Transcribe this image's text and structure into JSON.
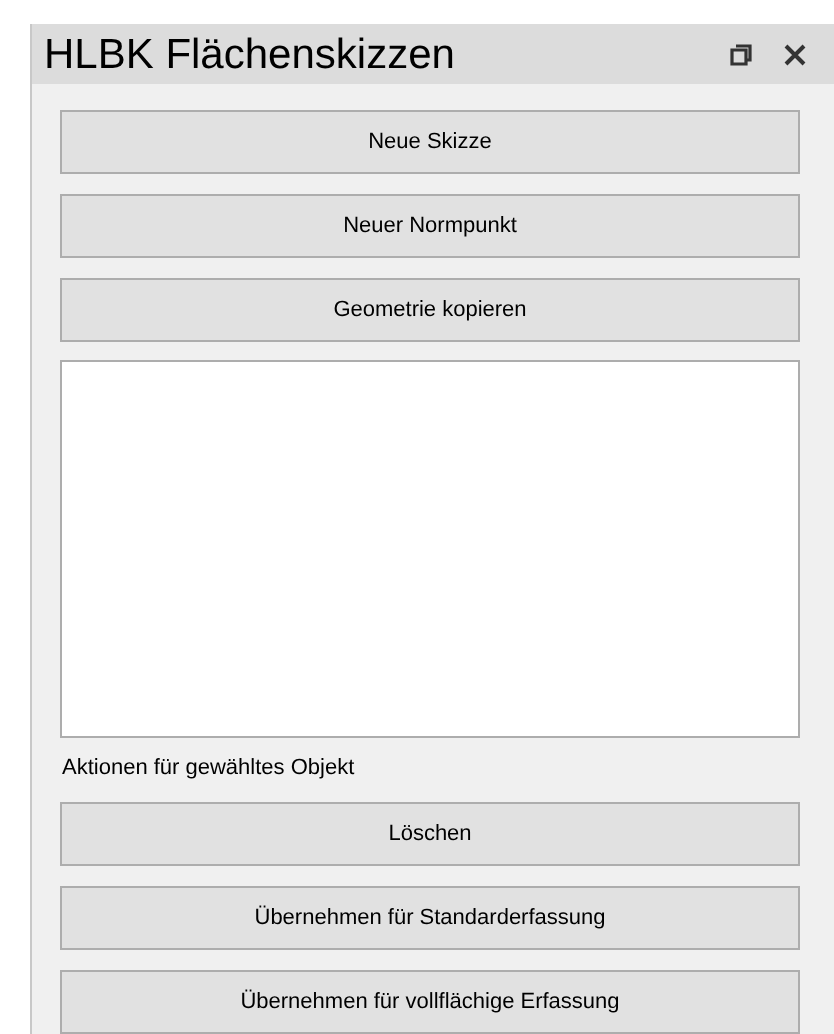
{
  "window": {
    "title": "HLBK Flächenskizzen"
  },
  "top_buttons": [
    "Neue Skizze",
    "Neuer Normpunkt",
    "Geometrie kopieren"
  ],
  "section_label": "Aktionen für gewähltes Objekt",
  "action_buttons": [
    "Löschen",
    "Übernehmen für Standarderfassung",
    "Übernehmen für vollflächige Erfassung"
  ]
}
